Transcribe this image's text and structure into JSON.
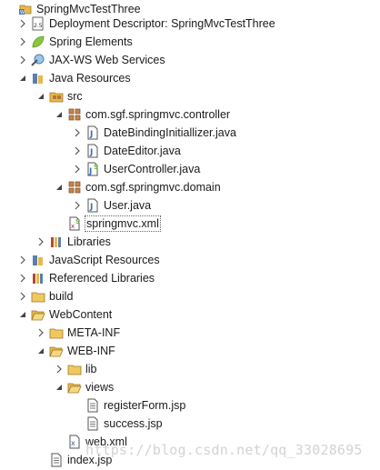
{
  "tree": {
    "items": [
      {
        "label": "SpringMvcTestThree",
        "icon": "project-icon",
        "expanded": true
      },
      {
        "label": "Deployment Descriptor: SpringMvcTestThree",
        "icon": "deployment-descriptor-icon",
        "expanded": false
      },
      {
        "label": "Spring Elements",
        "icon": "spring-leaf-icon",
        "expanded": false
      },
      {
        "label": "JAX-WS Web Services",
        "icon": "web-services-icon",
        "expanded": false
      },
      {
        "label": "Java Resources",
        "icon": "java-resources-icon",
        "expanded": true
      },
      {
        "label": "src",
        "icon": "source-folder-icon",
        "expanded": true
      },
      {
        "label": "com.sgf.springmvc.controller",
        "icon": "package-icon",
        "expanded": true
      },
      {
        "label": "DateBindingInitiallizer.java",
        "icon": "java-file-icon",
        "expanded": false
      },
      {
        "label": "DateEditor.java",
        "icon": "java-file-icon",
        "expanded": false
      },
      {
        "label": "UserController.java",
        "icon": "spring-java-file-icon",
        "expanded": false
      },
      {
        "label": "com.sgf.springmvc.domain",
        "icon": "package-icon",
        "expanded": true
      },
      {
        "label": "User.java",
        "icon": "java-file-icon",
        "expanded": false
      },
      {
        "label": "springmvc.xml",
        "icon": "spring-xml-file-icon",
        "expanded": false
      },
      {
        "label": "Libraries",
        "icon": "libraries-icon",
        "expanded": false
      },
      {
        "label": "JavaScript Resources",
        "icon": "javascript-resources-icon",
        "expanded": false
      },
      {
        "label": "Referenced Libraries",
        "icon": "libraries-icon",
        "expanded": false
      },
      {
        "label": "build",
        "icon": "folder-icon",
        "expanded": false
      },
      {
        "label": "WebContent",
        "icon": "folder-icon",
        "expanded": true
      },
      {
        "label": "META-INF",
        "icon": "folder-icon",
        "expanded": false
      },
      {
        "label": "WEB-INF",
        "icon": "folder-icon",
        "expanded": true
      },
      {
        "label": "lib",
        "icon": "folder-icon",
        "expanded": false
      },
      {
        "label": "views",
        "icon": "folder-icon",
        "expanded": true
      },
      {
        "label": "registerForm.jsp",
        "icon": "jsp-file-icon",
        "expanded": false
      },
      {
        "label": "success.jsp",
        "icon": "jsp-file-icon",
        "expanded": false
      },
      {
        "label": "web.xml",
        "icon": "xml-file-icon",
        "expanded": false
      },
      {
        "label": "index.jsp",
        "icon": "jsp-file-icon",
        "expanded": false
      }
    ]
  },
  "watermark": "https://blog.csdn.net/qq_33028695",
  "colors": {
    "folder": "#e8b84a",
    "package": "#b8733a",
    "spring": "#6cb33f",
    "java": "#3a6fb5"
  }
}
